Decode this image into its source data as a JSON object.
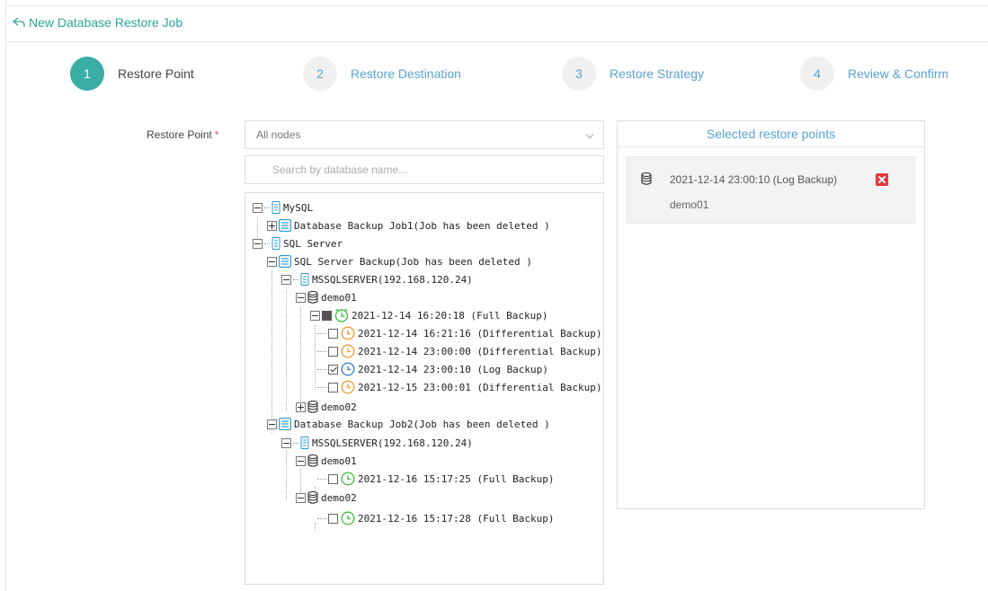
{
  "header": {
    "title": "New Database Restore Job"
  },
  "steps": [
    {
      "num": "1",
      "label": "Restore Point",
      "active": true
    },
    {
      "num": "2",
      "label": "Restore Destination",
      "active": false
    },
    {
      "num": "3",
      "label": "Restore Strategy",
      "active": false
    },
    {
      "num": "4",
      "label": "Review & Confirm",
      "active": false
    }
  ],
  "form": {
    "restore_point_label": "Restore Point",
    "required_mark": "*",
    "node_select_value": "All nodes",
    "search_placeholder": "Search by database name..."
  },
  "tree": {
    "mysql": "MySQL",
    "job1": "Database Backup Job1(Job has been deleted )",
    "sqlserver": "SQL Server",
    "sqljob": "SQL Server Backup(Job has been deleted )",
    "instance1": "MSSQLSERVER(192.168.120.24)",
    "db1": "demo01",
    "full1": "2021-12-14 16:20:18 (Full Backup)",
    "diff1": "2021-12-14 16:21:16 (Differential Backup)",
    "diff2": "2021-12-14 23:00:00 (Differential Backup)",
    "log1": "2021-12-14 23:00:10 (Log Backup)",
    "diff3": "2021-12-15 23:00:01 (Differential Backup)",
    "db2": "demo02",
    "job2": "Database Backup Job2(Job has been deleted )",
    "instance2": "MSSQLSERVER(192.168.120.24)",
    "db3": "demo01",
    "full2": "2021-12-16 15:17:25 (Full Backup)",
    "db4": "demo02",
    "full3": "2021-12-16 15:17:28 (Full Backup)"
  },
  "selected": {
    "title": "Selected restore points",
    "items": [
      {
        "restore_point": "2021-12-14 23:00:10 (Log Backup)",
        "database": "demo01"
      }
    ]
  },
  "colors": {
    "accent": "#3aada4",
    "link": "#5aa0d6",
    "full": "#46c34a",
    "diff": "#f39c38",
    "log": "#3b82d6",
    "remove": "#e0383e"
  }
}
